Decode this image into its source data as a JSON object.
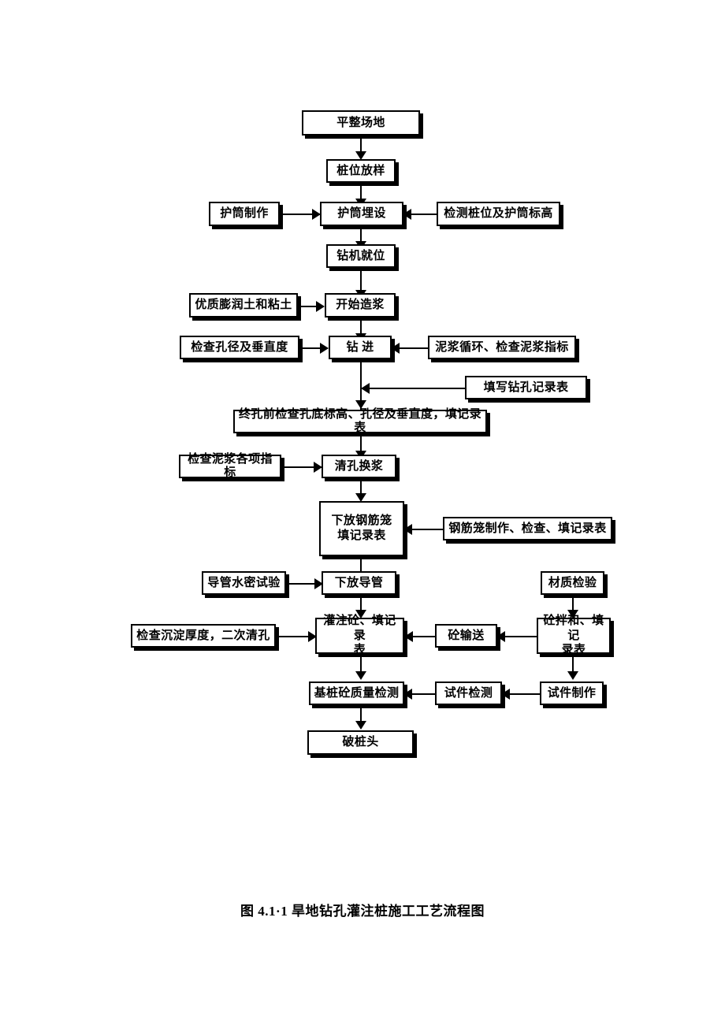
{
  "document": {
    "caption": "图 4.1·1 旱地钻孔灌注桩施工工艺流程图",
    "title": "旱地钻孔灌注桩施工工艺流程图",
    "figure_number": "图 4.1·1"
  },
  "diagram": {
    "type": "flowchart",
    "orientation": "top-to-bottom",
    "style": {
      "box_fill": "#ffffff",
      "box_border": "#000000",
      "box_shadow": "#000000",
      "connector_color": "#000000",
      "background": "#ffffff"
    },
    "nodes": [
      {
        "id": "n1",
        "label": "平整场地",
        "column": "main"
      },
      {
        "id": "n2",
        "label": "桩位放样",
        "column": "main"
      },
      {
        "id": "n3",
        "label": "护筒制作",
        "column": "left"
      },
      {
        "id": "n4",
        "label": "护筒埋设",
        "column": "main"
      },
      {
        "id": "n5",
        "label": "检测桩位及护筒标高",
        "column": "right"
      },
      {
        "id": "n6",
        "label": "钻机就位",
        "column": "main"
      },
      {
        "id": "n7",
        "label": "优质膨润土和粘土",
        "column": "left"
      },
      {
        "id": "n8",
        "label": "开始造浆",
        "column": "main"
      },
      {
        "id": "n9",
        "label": "检查孔径及垂直度",
        "column": "left"
      },
      {
        "id": "n10",
        "label": "钻  进",
        "column": "main"
      },
      {
        "id": "n11",
        "label": "泥浆循环、检查泥浆指标",
        "column": "right"
      },
      {
        "id": "n12",
        "label": "填写钻孔记录表",
        "column": "right"
      },
      {
        "id": "n13",
        "label": "终孔前检查孔底标高、孔径及垂直度，填记录表",
        "column": "main"
      },
      {
        "id": "n14",
        "label": "检查泥浆各项指标",
        "column": "left"
      },
      {
        "id": "n15",
        "label": "清孔换浆",
        "column": "main"
      },
      {
        "id": "n16",
        "label_line1": "下放钢筋笼",
        "label_line2": "填记录表",
        "column": "main"
      },
      {
        "id": "n17",
        "label": "钢筋笼制作、检查、填记录表",
        "column": "right"
      },
      {
        "id": "n18",
        "label": "导管水密试验",
        "column": "left"
      },
      {
        "id": "n19",
        "label": "下放导管",
        "column": "main"
      },
      {
        "id": "n20",
        "label": "材质检验",
        "column": "right"
      },
      {
        "id": "n21",
        "label": "检查沉淀厚度，二次清孔",
        "column": "left"
      },
      {
        "id": "n22",
        "label_line1": "灌注砼、填记录",
        "label_line2": "表",
        "column": "main"
      },
      {
        "id": "n23",
        "label": "砼输送",
        "column": "right"
      },
      {
        "id": "n24",
        "label_line1": "砼拌和、填记",
        "label_line2": "录表",
        "column": "right"
      },
      {
        "id": "n25",
        "label": "基桩砼质量检测",
        "column": "main"
      },
      {
        "id": "n26",
        "label": "试件检测",
        "column": "right"
      },
      {
        "id": "n27",
        "label": "试件制作",
        "column": "right"
      },
      {
        "id": "n28",
        "label": "破桩头",
        "column": "main"
      }
    ],
    "edges": [
      {
        "from": "n1",
        "to": "n2",
        "direction": "down"
      },
      {
        "from": "n2",
        "to": "n4",
        "direction": "down"
      },
      {
        "from": "n3",
        "to": "n4",
        "direction": "right"
      },
      {
        "from": "n5",
        "to": "n4",
        "direction": "left"
      },
      {
        "from": "n4",
        "to": "n6",
        "direction": "down"
      },
      {
        "from": "n6",
        "to": "n8",
        "direction": "down"
      },
      {
        "from": "n7",
        "to": "n8",
        "direction": "right"
      },
      {
        "from": "n8",
        "to": "n10",
        "direction": "down"
      },
      {
        "from": "n9",
        "to": "n10",
        "direction": "right"
      },
      {
        "from": "n11",
        "to": "n10",
        "direction": "left"
      },
      {
        "from": "n12",
        "to": "n13",
        "direction": "left"
      },
      {
        "from": "n10",
        "to": "n13",
        "direction": "down"
      },
      {
        "from": "n13",
        "to": "n15",
        "direction": "down"
      },
      {
        "from": "n14",
        "to": "n15",
        "direction": "right"
      },
      {
        "from": "n15",
        "to": "n16",
        "direction": "down"
      },
      {
        "from": "n17",
        "to": "n16",
        "direction": "left"
      },
      {
        "from": "n16",
        "to": "n19",
        "direction": "down"
      },
      {
        "from": "n18",
        "to": "n19",
        "direction": "right"
      },
      {
        "from": "n19",
        "to": "n22",
        "direction": "down"
      },
      {
        "from": "n20",
        "to": "n24",
        "direction": "down"
      },
      {
        "from": "n21",
        "to": "n22",
        "direction": "right"
      },
      {
        "from": "n23",
        "to": "n22",
        "direction": "left"
      },
      {
        "from": "n24",
        "to": "n23",
        "direction": "left"
      },
      {
        "from": "n22",
        "to": "n25",
        "direction": "down"
      },
      {
        "from": "n26",
        "to": "n25",
        "direction": "left"
      },
      {
        "from": "n27",
        "to": "n26",
        "direction": "left"
      },
      {
        "from": "n24",
        "to": "n27",
        "direction": "down"
      },
      {
        "from": "n25",
        "to": "n28",
        "direction": "down"
      }
    ]
  }
}
